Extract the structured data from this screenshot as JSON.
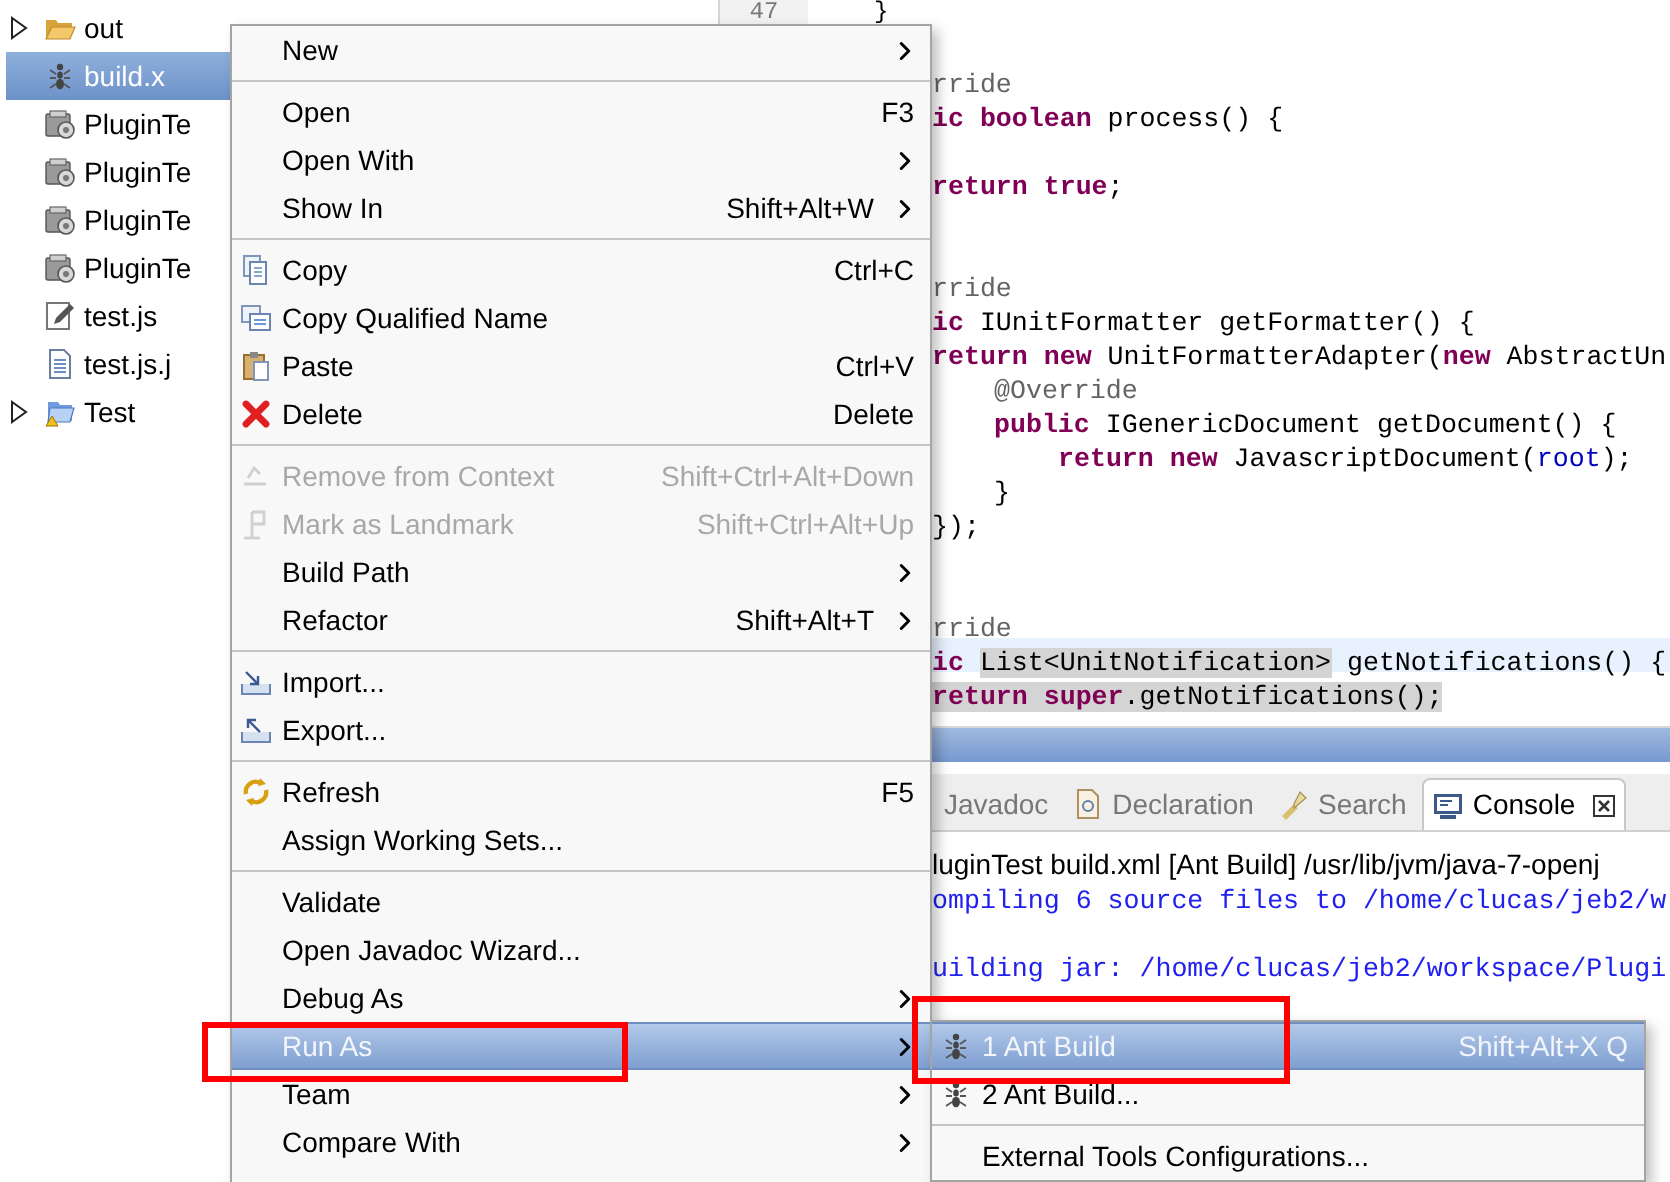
{
  "tree": [
    {
      "children": [
        {
          "label": "out",
          "kind": "folder",
          "expanded": false,
          "selected": false
        },
        {
          "label": "build.x",
          "kind": "ant",
          "selected": true
        },
        {
          "label": "PluginTe",
          "kind": "jar",
          "selected": false
        },
        {
          "label": "PluginTe",
          "kind": "jar",
          "selected": false
        },
        {
          "label": "PluginTe",
          "kind": "jar",
          "selected": false
        },
        {
          "label": "PluginTe",
          "kind": "jar",
          "selected": false
        },
        {
          "label": "test.js",
          "kind": "jsfile",
          "selected": false
        },
        {
          "label": "test.js.j",
          "kind": "file",
          "selected": false
        }
      ]
    },
    {
      "label": "Test",
      "kind": "project",
      "expanded": false,
      "selected": false
    }
  ],
  "editor": {
    "top_line": {
      "line_number": "47",
      "text": "}"
    },
    "lines": [
      {
        "kind": "code",
        "current": false,
        "segments": [
          {
            "text": "rride",
            "kind": "annotation",
            "selected": false
          }
        ]
      },
      {
        "kind": "code",
        "current": false,
        "segments": [
          {
            "text": "ic boolean",
            "kind": "keyword",
            "selected": false
          },
          {
            "text": " process() {",
            "kind": "plain",
            "selected": false
          }
        ]
      },
      {
        "kind": "blank"
      },
      {
        "kind": "code",
        "current": false,
        "segments": [
          {
            "text": "return true",
            "kind": "keyword",
            "selected": false
          },
          {
            "text": ";",
            "kind": "plain",
            "selected": false
          }
        ]
      },
      {
        "kind": "blank"
      },
      {
        "kind": "blank"
      },
      {
        "kind": "code",
        "current": false,
        "segments": [
          {
            "text": "rride",
            "kind": "annotation",
            "selected": false
          }
        ]
      },
      {
        "kind": "code",
        "current": false,
        "segments": [
          {
            "text": "ic",
            "kind": "keyword",
            "selected": false
          },
          {
            "text": " IUnitFormatter getFormatter() {",
            "kind": "plain",
            "selected": false
          }
        ]
      },
      {
        "kind": "code",
        "current": false,
        "segments": [
          {
            "text": "return new",
            "kind": "keyword",
            "selected": false
          },
          {
            "text": " UnitFormatterAdapter(",
            "kind": "plain",
            "selected": false
          },
          {
            "text": "new",
            "kind": "keyword",
            "selected": false
          },
          {
            "text": " AbstractUn",
            "kind": "plain",
            "selected": false
          }
        ]
      },
      {
        "kind": "code-indented",
        "current": false,
        "segments": [
          {
            "text": "@Override",
            "kind": "annotation",
            "selected": false
          }
        ]
      },
      {
        "kind": "code-indented",
        "current": false,
        "segments": [
          {
            "text": "public",
            "kind": "keyword",
            "selected": false
          },
          {
            "text": " IGenericDocument getDocument() {",
            "kind": "plain",
            "selected": false
          }
        ]
      },
      {
        "kind": "code-indented-twice",
        "current": false,
        "segments": [
          {
            "text": "return new",
            "kind": "keyword",
            "selected": false
          },
          {
            "text": " JavascriptDocument(",
            "kind": "plain",
            "selected": false
          },
          {
            "text": "root",
            "kind": "field",
            "selected": false
          },
          {
            "text": ");",
            "kind": "plain",
            "selected": false
          }
        ]
      },
      {
        "kind": "code-indented",
        "current": false,
        "segments": [
          {
            "text": "}",
            "kind": "plain",
            "selected": false
          }
        ]
      },
      {
        "kind": "code",
        "current": false,
        "segments": [
          {
            "text": "});",
            "kind": "plain",
            "selected": false
          }
        ]
      },
      {
        "kind": "blank"
      },
      {
        "kind": "blank"
      },
      {
        "kind": "code",
        "current": false,
        "segments": [
          {
            "text": "rride",
            "kind": "annotation",
            "selected": false
          }
        ]
      },
      {
        "kind": "code",
        "current": true,
        "segments": [
          {
            "text": "ic ",
            "kind": "keyword",
            "selected": false
          },
          {
            "text": "List<UnitNotification>",
            "kind": "plain",
            "selected": true
          },
          {
            "text": " getNotifications() {",
            "kind": "plain",
            "selected": false
          }
        ]
      },
      {
        "kind": "code",
        "current": false,
        "segments": [
          {
            "text": "return super",
            "kind": "keyword",
            "selected": true
          },
          {
            "text": ".getNotifications();",
            "kind": "plain",
            "selected": true
          }
        ]
      }
    ]
  },
  "bottom_panel": {
    "tabs": [
      {
        "label": "Javadoc",
        "kind": "javadoc",
        "selected": false,
        "closable": false
      },
      {
        "label": "Declaration",
        "kind": "declaration",
        "selected": false,
        "closable": false
      },
      {
        "label": "Search",
        "kind": "search",
        "selected": false,
        "closable": false
      },
      {
        "label": "Console",
        "kind": "console",
        "selected": true,
        "closable": true
      }
    ],
    "console_lines": [
      {
        "kind": "title",
        "text": "luginTest build.xml [Ant Build] /usr/lib/jvm/java-7-openj"
      },
      {
        "kind": "output",
        "text": "ompiling 6 source files to /home/clucas/jeb2/w"
      },
      {
        "kind": "blank"
      },
      {
        "kind": "output",
        "text": "uilding jar: /home/clucas/jeb2/workspace/Plugi"
      }
    ]
  },
  "context_menu": [
    {
      "kind": "plain",
      "label": "New",
      "submenu": true,
      "disabled": false,
      "selected": false
    },
    {
      "kind": "separator"
    },
    {
      "kind": "plain",
      "label": "Open",
      "shortcut": "F3",
      "submenu": false,
      "disabled": false,
      "selected": false
    },
    {
      "kind": "plain",
      "label": "Open With",
      "submenu": true,
      "disabled": false,
      "selected": false
    },
    {
      "kind": "plain",
      "label": "Show In",
      "shortcut": "Shift+Alt+W",
      "submenu": true,
      "disabled": false,
      "selected": false
    },
    {
      "kind": "separator"
    },
    {
      "kind": "copy",
      "label": "Copy",
      "shortcut": "Ctrl+C",
      "submenu": false,
      "disabled": false,
      "selected": false
    },
    {
      "kind": "copy-name",
      "label": "Copy Qualified Name",
      "submenu": false,
      "disabled": false,
      "selected": false
    },
    {
      "kind": "paste",
      "label": "Paste",
      "shortcut": "Ctrl+V",
      "submenu": false,
      "disabled": false,
      "selected": false
    },
    {
      "kind": "delete",
      "label": "Delete",
      "shortcut": "Delete",
      "submenu": false,
      "disabled": false,
      "selected": false
    },
    {
      "kind": "separator"
    },
    {
      "kind": "remove-context",
      "label": "Remove from Context",
      "shortcut": "Shift+Ctrl+Alt+Down",
      "submenu": false,
      "disabled": true,
      "selected": false
    },
    {
      "kind": "landmark",
      "label": "Mark as Landmark",
      "shortcut": "Shift+Ctrl+Alt+Up",
      "submenu": false,
      "disabled": true,
      "selected": false
    },
    {
      "kind": "plain",
      "label": "Build Path",
      "submenu": true,
      "disabled": false,
      "selected": false
    },
    {
      "kind": "plain",
      "label": "Refactor",
      "shortcut": "Shift+Alt+T",
      "submenu": true,
      "disabled": false,
      "selected": false
    },
    {
      "kind": "separator"
    },
    {
      "kind": "import",
      "label": "Import...",
      "submenu": false,
      "disabled": false,
      "selected": false
    },
    {
      "kind": "export",
      "label": "Export...",
      "submenu": false,
      "disabled": false,
      "selected": false
    },
    {
      "kind": "separator"
    },
    {
      "kind": "refresh",
      "label": "Refresh",
      "shortcut": "F5",
      "submenu": false,
      "disabled": false,
      "selected": false
    },
    {
      "kind": "plain",
      "label": "Assign Working Sets...",
      "submenu": false,
      "disabled": false,
      "selected": false
    },
    {
      "kind": "separator"
    },
    {
      "kind": "plain",
      "label": "Validate",
      "submenu": false,
      "disabled": false,
      "selected": false
    },
    {
      "kind": "plain",
      "label": "Open Javadoc Wizard...",
      "submenu": false,
      "disabled": false,
      "selected": false
    },
    {
      "kind": "plain",
      "label": "Debug As",
      "submenu": true,
      "disabled": false,
      "selected": false
    },
    {
      "kind": "plain",
      "label": "Run As",
      "submenu": true,
      "disabled": false,
      "selected": true
    },
    {
      "kind": "plain",
      "label": "Team",
      "submenu": true,
      "disabled": false,
      "selected": false
    },
    {
      "kind": "plain",
      "label": "Compare With",
      "submenu": true,
      "disabled": false,
      "selected": false
    }
  ],
  "submenu": [
    {
      "kind": "ant",
      "label": "1 Ant Build",
      "shortcut": "Shift+Alt+X Q",
      "disabled": false,
      "selected": true
    },
    {
      "kind": "ant",
      "label": "2 Ant Build...",
      "disabled": false,
      "selected": false
    },
    {
      "kind": "separator"
    },
    {
      "kind": "plain",
      "label": "External Tools Configurations...",
      "disabled": false,
      "selected": false
    }
  ]
}
